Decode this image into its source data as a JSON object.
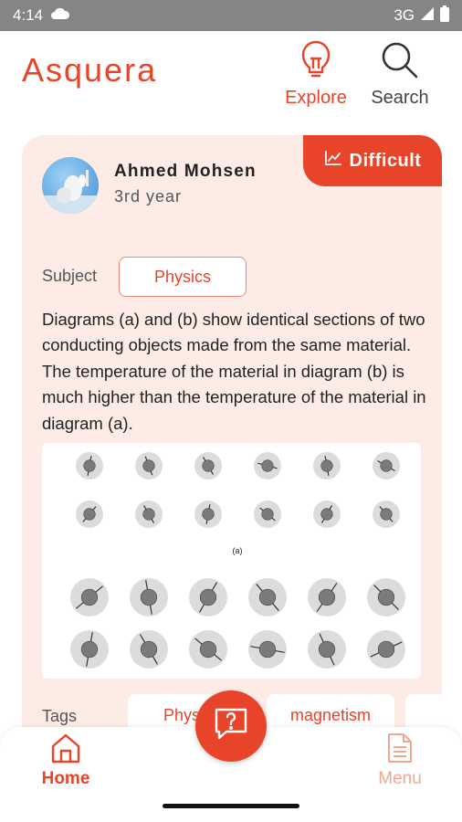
{
  "status": {
    "time": "4:14",
    "network": "3G"
  },
  "header": {
    "brand": "Asquera",
    "explore_label": "Explore",
    "search_label": "Search"
  },
  "post": {
    "difficulty": "Difficult",
    "author_name": "Ahmed Mohsen",
    "author_year": "3rd year",
    "subject_label": "Subject",
    "subject_value": "Physics",
    "question": "Diagrams (a) and (b) show identical sections of two conducting objects made from the same material. The temperature of the material in diagram (b) is much higher than the temperature of the material in diagram (a).",
    "figure_caption": "(a)",
    "tags_label": "Tags",
    "tags": [
      "Physics",
      "magnetism",
      ""
    ]
  },
  "bottom_nav": {
    "home_label": "Home",
    "menu_label": "Menu"
  },
  "colors": {
    "accent": "#e8442a",
    "card_bg": "#fdece5",
    "status_bar": "#858585"
  }
}
